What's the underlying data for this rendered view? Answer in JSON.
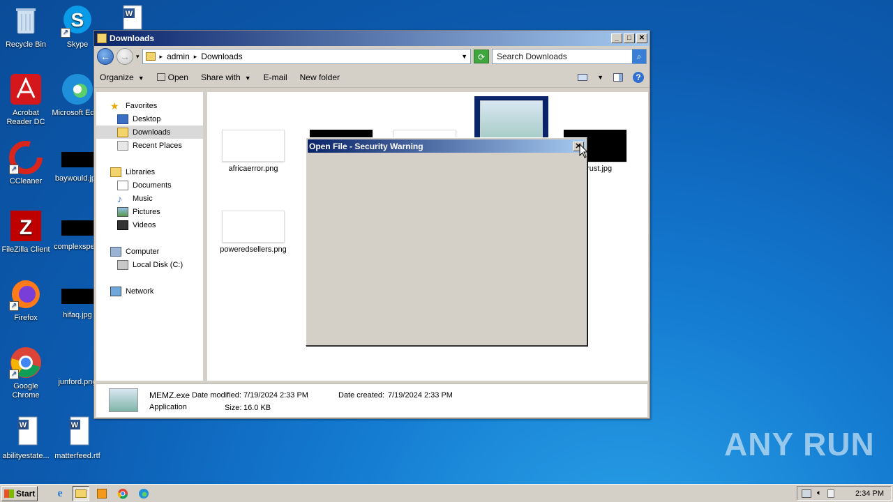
{
  "desktop": {
    "icons": [
      {
        "label": "Recycle Bin",
        "icon": "recycle-bin-icon"
      },
      {
        "label": "Skype",
        "icon": "skype-icon"
      },
      {
        "label": "Acrobat Reader DC",
        "icon": "acrobat-icon"
      },
      {
        "label": "Microsoft Edge",
        "icon": "edge-icon"
      },
      {
        "label": "CCleaner",
        "icon": "ccleaner-icon"
      },
      {
        "label": "baywould.jpg",
        "icon": "image-file-icon"
      },
      {
        "label": "FileZilla Client",
        "icon": "filezilla-icon"
      },
      {
        "label": "complexspe...",
        "icon": "image-file-icon"
      },
      {
        "label": "Firefox",
        "icon": "firefox-icon"
      },
      {
        "label": "hifaq.jpg",
        "icon": "image-file-icon"
      },
      {
        "label": "Google Chrome",
        "icon": "chrome-icon"
      },
      {
        "label": "junford.png",
        "icon": "image-file-icon"
      },
      {
        "label": "abilityestate...",
        "icon": "word-doc-icon"
      },
      {
        "label": "matterfeed.rtf",
        "icon": "word-doc-icon"
      }
    ]
  },
  "explorer": {
    "title": "Downloads",
    "breadcrumb": [
      "admin",
      "Downloads"
    ],
    "search_placeholder": "Search Downloads",
    "toolbar": {
      "organize": "Organize",
      "open": "Open",
      "share_with": "Share with",
      "email": "E-mail",
      "new_folder": "New folder"
    },
    "nav": {
      "favorites": "Favorites",
      "desktop": "Desktop",
      "downloads": "Downloads",
      "recent_places": "Recent Places",
      "libraries": "Libraries",
      "documents": "Documents",
      "music": "Music",
      "pictures": "Pictures",
      "videos": "Videos",
      "computer": "Computer",
      "local_disk": "Local Disk (C:)",
      "network": "Network"
    },
    "files": {
      "africaerror": "africaerror.png",
      "trust": "...trust.jpg",
      "poweredsellers": "poweredsellers.png"
    },
    "details": {
      "name": "MEMZ.exe",
      "type": "Application",
      "date_modified_label": "Date modified:",
      "date_modified": "7/19/2024 2:33 PM",
      "date_created_label": "Date created:",
      "date_created": "7/19/2024 2:33 PM",
      "size_label": "Size:",
      "size": "16.0 KB"
    }
  },
  "dialog": {
    "title": "Open File - Security Warning",
    "close": "✕"
  },
  "taskbar": {
    "start": "Start",
    "clock": "2:34 PM"
  },
  "watermark": "ANY RUN"
}
